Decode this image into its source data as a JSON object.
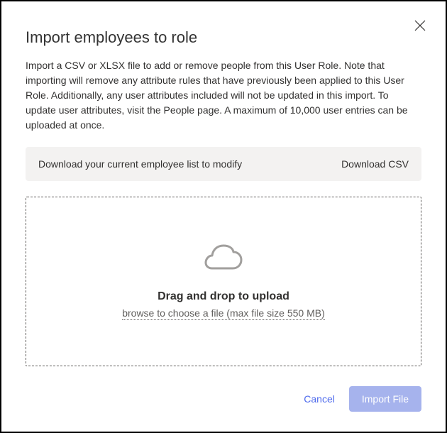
{
  "dialog": {
    "title": "Import employees to role",
    "description": "Import a CSV or XLSX file to add or remove people from this User Role. Note that importing will remove any attribute rules that have previously been applied to this User Role. Additionally, any user attributes included will not be updated in this import. To update user attributes, visit the People page. A maximum of 10,000 user entries can be uploaded at once."
  },
  "download": {
    "label": "Download your current employee list to modify",
    "action": "Download CSV"
  },
  "dropzone": {
    "title": "Drag and drop to upload",
    "subtitle": "browse to choose a file (max file size 550 MB)"
  },
  "footer": {
    "cancel": "Cancel",
    "import": "Import File"
  }
}
